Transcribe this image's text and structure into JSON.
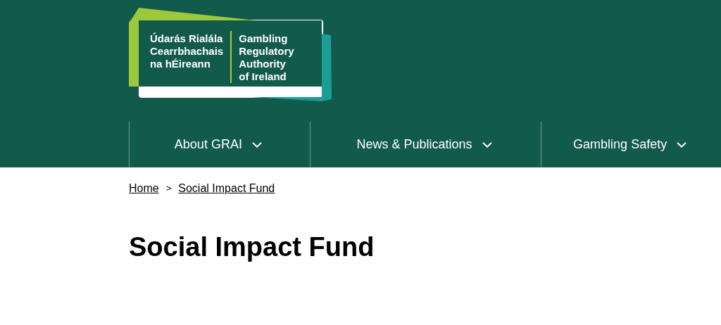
{
  "logo": {
    "irish_lines": [
      "Údarás Rialála",
      "Cearrbhachais",
      "na hÉireann"
    ],
    "english_lines": [
      "Gambling",
      "Regulatory",
      "Authority",
      "of Ireland"
    ]
  },
  "nav": [
    {
      "label": "About GRAI"
    },
    {
      "label": "News & Publications"
    },
    {
      "label": "Gambling Safety"
    }
  ],
  "breadcrumb": {
    "items": [
      "Home",
      "Social Impact Fund"
    ],
    "separator": ">"
  },
  "page_title": "Social Impact Fund"
}
